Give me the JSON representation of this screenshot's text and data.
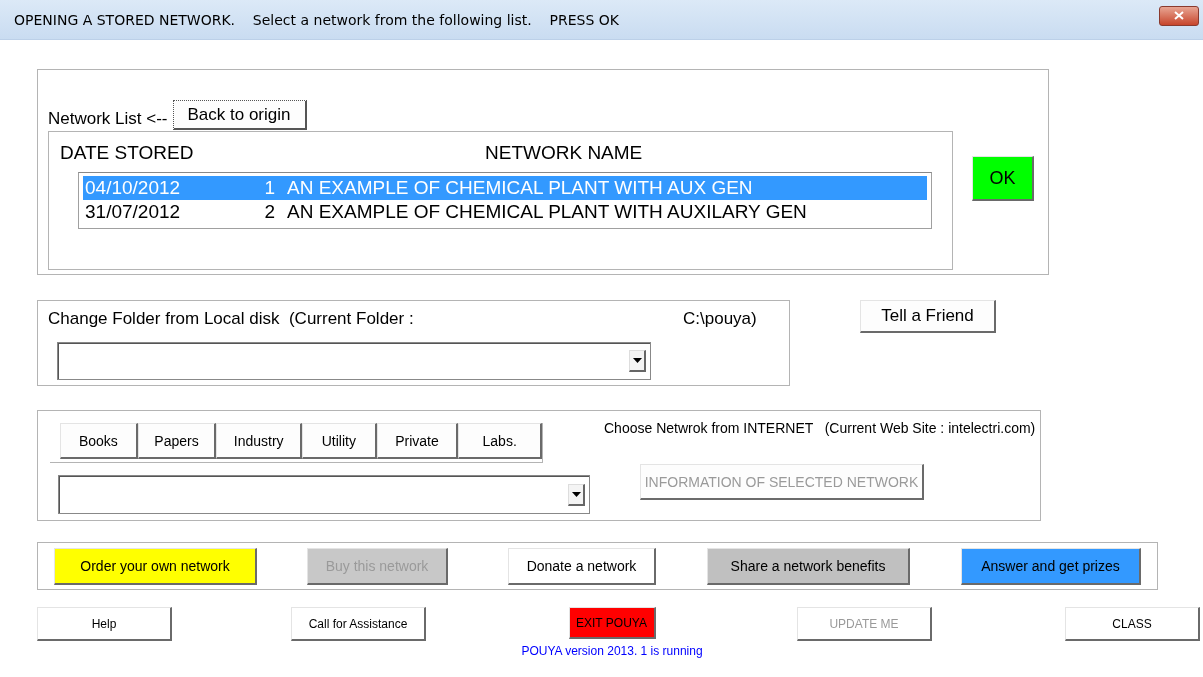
{
  "window": {
    "title": "OPENING A STORED NETWORK.    Select a network from the following list.    PRESS OK"
  },
  "network_list": {
    "label": "Network List <--",
    "back_button": "Back to origin",
    "columns": [
      "DATE STORED",
      "NETWORK NAME"
    ],
    "rows": [
      {
        "date": "04/10/2012",
        "number": "1",
        "name": "AN EXAMPLE OF CHEMICAL PLANT WITH AUX GEN",
        "selected": true
      },
      {
        "date": "31/07/2012",
        "number": "2",
        "name": "AN EXAMPLE OF CHEMICAL PLANT WITH AUXILARY GEN",
        "selected": false
      }
    ]
  },
  "ok_button": "OK",
  "local_folder": {
    "label": "Change Folder from Local disk  (Current Folder :",
    "path": "C:\\pouya)"
  },
  "tell_friend_button": "Tell a Friend",
  "internet": {
    "tabs": [
      {
        "label": "Books",
        "selected": false
      },
      {
        "label": "Papers",
        "selected": false
      },
      {
        "label": "Industry",
        "selected": false
      },
      {
        "label": "Utility",
        "selected": false
      },
      {
        "label": "Private",
        "selected": false
      },
      {
        "label": "Labs.",
        "selected": false
      }
    ],
    "label": "Choose Netwrok from INTERNET   (Current Web Site : intelectri.com)",
    "info_button": {
      "label": "INFORMATION OF SELECTED NETWORK",
      "disabled": true
    }
  },
  "action_buttons": [
    {
      "label": "Order your own network",
      "color": "#ffff00",
      "disabled": false
    },
    {
      "label": "Buy this network",
      "color": "#c8c8c8",
      "disabled": true
    },
    {
      "label": "Donate a network",
      "color": "#ffffff",
      "disabled": false
    },
    {
      "label": "Share a network benefits",
      "color": "#c0c0c0",
      "disabled": false
    },
    {
      "label": "Answer and get prizes",
      "color": "#3399ff",
      "disabled": false
    }
  ],
  "footer_buttons": [
    {
      "label": "Help",
      "color": "#ffffff",
      "disabled": false
    },
    {
      "label": "Call for Assistance",
      "color": "#ffffff",
      "disabled": false
    },
    {
      "label": "EXIT POUYA",
      "color": "#ff0000",
      "disabled": false
    },
    {
      "label": "UPDATE ME",
      "color": "#ffffff",
      "disabled": true
    },
    {
      "label": "CLASS",
      "color": "#ffffff",
      "disabled": false
    }
  ],
  "version_text": "POUYA version 2013. 1 is running"
}
